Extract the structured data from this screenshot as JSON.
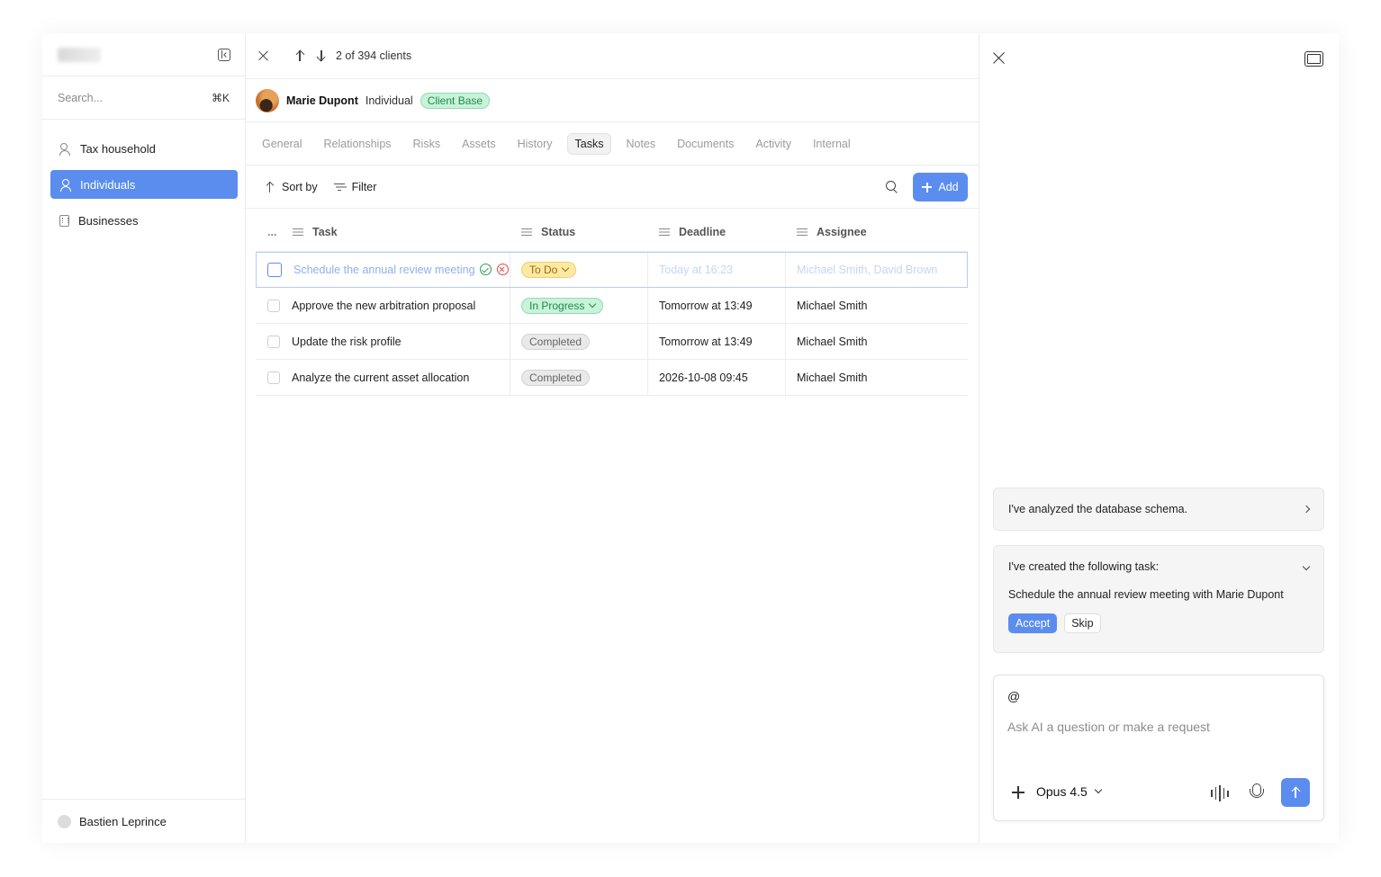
{
  "sidebar": {
    "search_placeholder": "Search...",
    "search_shortcut": "⌘K",
    "items": [
      {
        "label": "Tax household",
        "icon": "people-icon"
      },
      {
        "label": "Individuals",
        "icon": "person-icon",
        "active": true
      },
      {
        "label": "Businesses",
        "icon": "building-icon"
      }
    ],
    "user": "Bastien Leprince"
  },
  "main": {
    "pager": "2 of 394 clients",
    "client": {
      "name": "Marie Dupont",
      "type": "Individual",
      "badge": "Client Base"
    },
    "tabs": [
      "General",
      "Relationships",
      "Risks",
      "Assets",
      "History",
      "Tasks",
      "Notes",
      "Documents",
      "Activity",
      "Internal"
    ],
    "active_tab": "Tasks",
    "toolbar": {
      "sort": "Sort by",
      "filter": "Filter",
      "add": "Add"
    },
    "table": {
      "headers": {
        "more": "...",
        "task": "Task",
        "status": "Status",
        "deadline": "Deadline",
        "assignee": "Assignee"
      },
      "rows": [
        {
          "task": "Schedule the annual review meeting",
          "status": "To Do",
          "deadline": "Today at 16:23",
          "assignee": "Michael Smith, David Brown"
        },
        {
          "task": "Approve the new arbitration proposal",
          "status": "In Progress",
          "deadline": "Tomorrow at 13:49",
          "assignee": "Michael Smith"
        },
        {
          "task": "Update the risk profile",
          "status": "Completed",
          "deadline": "Tomorrow at 13:49",
          "assignee": "Michael Smith"
        },
        {
          "task": "Analyze the current asset allocation",
          "status": "Completed",
          "deadline": "2026-10-08 09:45",
          "assignee": "Michael Smith"
        }
      ]
    }
  },
  "ai": {
    "card1": "I've analyzed the database schema.",
    "card2_title": "I've created the following task:",
    "card2_body": "Schedule the annual review meeting with Marie Dupont",
    "accept": "Accept",
    "skip": "Skip",
    "composer_at": "@",
    "composer_placeholder": "Ask AI a question or make a request",
    "model": "Opus 4.5"
  },
  "colors": {
    "accent": "#5b8def",
    "green": "#1d8b52",
    "yellow": "#a36a00"
  }
}
